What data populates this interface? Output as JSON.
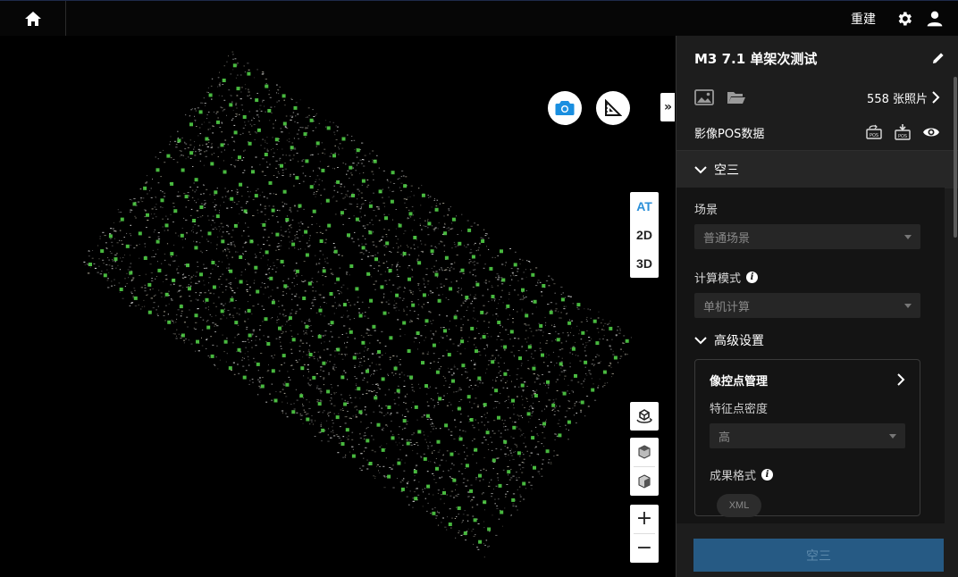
{
  "topbar": {
    "home_icon": "home-icon",
    "rebuild_label": "重建",
    "settings_icon": "gear-icon",
    "user_icon": "user-icon"
  },
  "map_tools": {
    "camera_icon": "camera-icon",
    "measure_icon": "ruler-triangle-icon",
    "collapse_label": "»",
    "view_modes": [
      "AT",
      "2D",
      "3D"
    ],
    "active_view": "AT",
    "zoom_in_label": "+",
    "zoom_out_label": "−"
  },
  "panel": {
    "project_title": "M3 7.1 单架次测试",
    "photo_count": "558 张照片",
    "pos_label": "影像POS数据",
    "at_section": "空三",
    "scene_label": "场景",
    "scene_value": "普通场景",
    "compute_label": "计算模式",
    "compute_value": "单机计算",
    "advanced_label": "高级设置",
    "gcp_label": "像控点管理",
    "density_label": "特征点密度",
    "density_value": "高",
    "output_label": "成果格式",
    "output_chip": "XML",
    "run_button": "空三"
  },
  "colors": {
    "accent_blue": "#2b8fd8",
    "run_button_bg": "#265a84",
    "camera_point_green": "#55d84a"
  }
}
